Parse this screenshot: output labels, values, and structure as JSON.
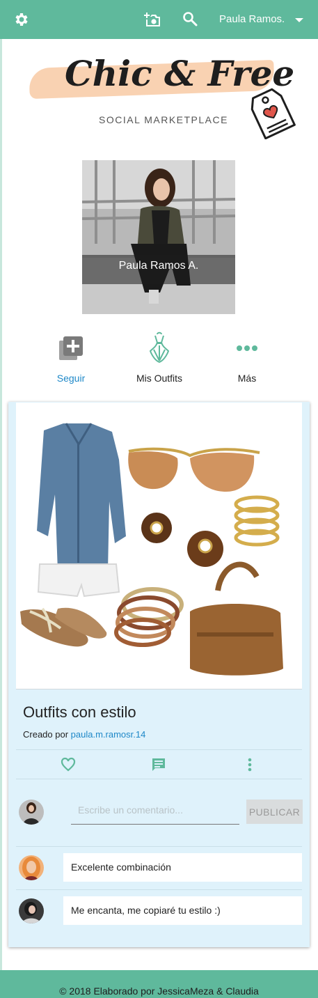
{
  "topbar": {
    "user_name": "Paula Ramos.",
    "icons": [
      "gear-icon",
      "add-photo-icon",
      "search-icon",
      "caret-down-icon"
    ],
    "color": "#5fb99c"
  },
  "logo": {
    "title": "Chic & Free",
    "subtitle": "SOCIAL MARKETPLACE"
  },
  "profile": {
    "name": "Paula Ramos A."
  },
  "actions": [
    {
      "label": "Seguir",
      "icon": "add-box-icon"
    },
    {
      "label": "Mis Outfits",
      "icon": "dress-icon"
    },
    {
      "label": "Más",
      "icon": "more-dots-icon"
    }
  ],
  "post": {
    "title": "Outfits con estilo",
    "created_prefix": "Creado por",
    "author": "paula.m.ramosr.14",
    "comment_placeholder": "Escribe un comentario...",
    "publish_label": "PUBLICAR",
    "comments": [
      {
        "text": "Excelente combinación"
      },
      {
        "text": "Me encanta, me copiaré tu estilo :)"
      }
    ]
  },
  "footer": {
    "text": "© 2018 Elaborado por JessicaMeza & Claudia"
  },
  "colors": {
    "brand": "#5fb99c",
    "link": "#1e88c8",
    "card_bg": "#dff2fb"
  }
}
